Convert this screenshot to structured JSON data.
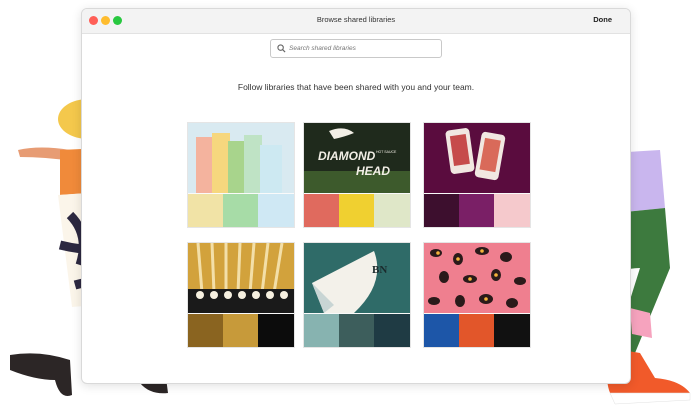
{
  "window": {
    "title": "Browse shared libraries",
    "done_label": "Done"
  },
  "search": {
    "placeholder": "Search shared libraries",
    "icon": "search-icon"
  },
  "headline": "Follow libraries that have been shared with you and your team.",
  "libraries": [
    {
      "art_text": [],
      "swatches": [
        "#f1e3a6",
        "#a7dca7",
        "#cfe8f4"
      ]
    },
    {
      "art_text": [
        "DIAMOND",
        "HOT SAUCE",
        "HEAD"
      ],
      "swatches": [
        "#e06a5e",
        "#f0d030",
        "#dfe7c8"
      ]
    },
    {
      "art_text": [],
      "swatches": [
        "#3d0f2e",
        "#7a1f66",
        "#f5c9cc"
      ]
    },
    {
      "art_text": [],
      "swatches": [
        "#8a6420",
        "#c79a3a",
        "#0c0c0c"
      ]
    },
    {
      "art_text": [
        "BN"
      ],
      "swatches": [
        "#87b3b0",
        "#3d5e5c",
        "#1f3b44"
      ]
    },
    {
      "art_text": [],
      "swatches": [
        "#1d56a8",
        "#e2562a",
        "#111111"
      ]
    }
  ]
}
